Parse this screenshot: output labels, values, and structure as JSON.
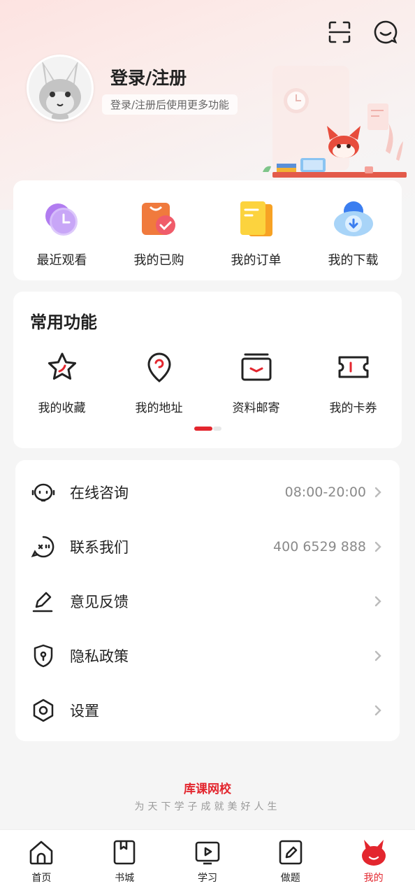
{
  "header": {
    "login_title": "登录/注册",
    "login_subtitle": "登录/注册后使用更多功能",
    "icons": [
      "scan-icon",
      "message-icon"
    ]
  },
  "quick_actions": [
    {
      "label": "最近观看",
      "icon": "recent-watch-icon"
    },
    {
      "label": "我的已购",
      "icon": "purchased-icon"
    },
    {
      "label": "我的订单",
      "icon": "orders-icon"
    },
    {
      "label": "我的下载",
      "icon": "download-icon"
    }
  ],
  "common_functions": {
    "title": "常用功能",
    "items": [
      {
        "label": "我的收藏",
        "icon": "star-icon"
      },
      {
        "label": "我的地址",
        "icon": "location-icon"
      },
      {
        "label": "资料邮寄",
        "icon": "mail-icon"
      },
      {
        "label": "我的卡券",
        "icon": "coupon-icon"
      }
    ],
    "page_indicator": {
      "current": 1,
      "total": 2
    }
  },
  "menu": [
    {
      "label": "在线咨询",
      "value": "08:00-20:00",
      "icon": "chat-icon"
    },
    {
      "label": "联系我们",
      "value": "400 6529 888",
      "icon": "phone-icon"
    },
    {
      "label": "意见反馈",
      "value": "",
      "icon": "edit-icon"
    },
    {
      "label": "隐私政策",
      "value": "",
      "icon": "shield-icon"
    },
    {
      "label": "设置",
      "value": "",
      "icon": "settings-icon"
    }
  ],
  "footer": {
    "brand": "库课网校",
    "slogan": "为天下学子成就美好人生"
  },
  "tabs": [
    {
      "label": "首页",
      "icon": "home-icon",
      "active": false
    },
    {
      "label": "书城",
      "icon": "bookstore-icon",
      "active": false
    },
    {
      "label": "学习",
      "icon": "study-icon",
      "active": false
    },
    {
      "label": "做题",
      "icon": "practice-icon",
      "active": false
    },
    {
      "label": "我的",
      "icon": "profile-icon",
      "active": true
    }
  ],
  "colors": {
    "accent": "#e3262e",
    "text": "#222222",
    "secondary": "#8a8a8a"
  }
}
